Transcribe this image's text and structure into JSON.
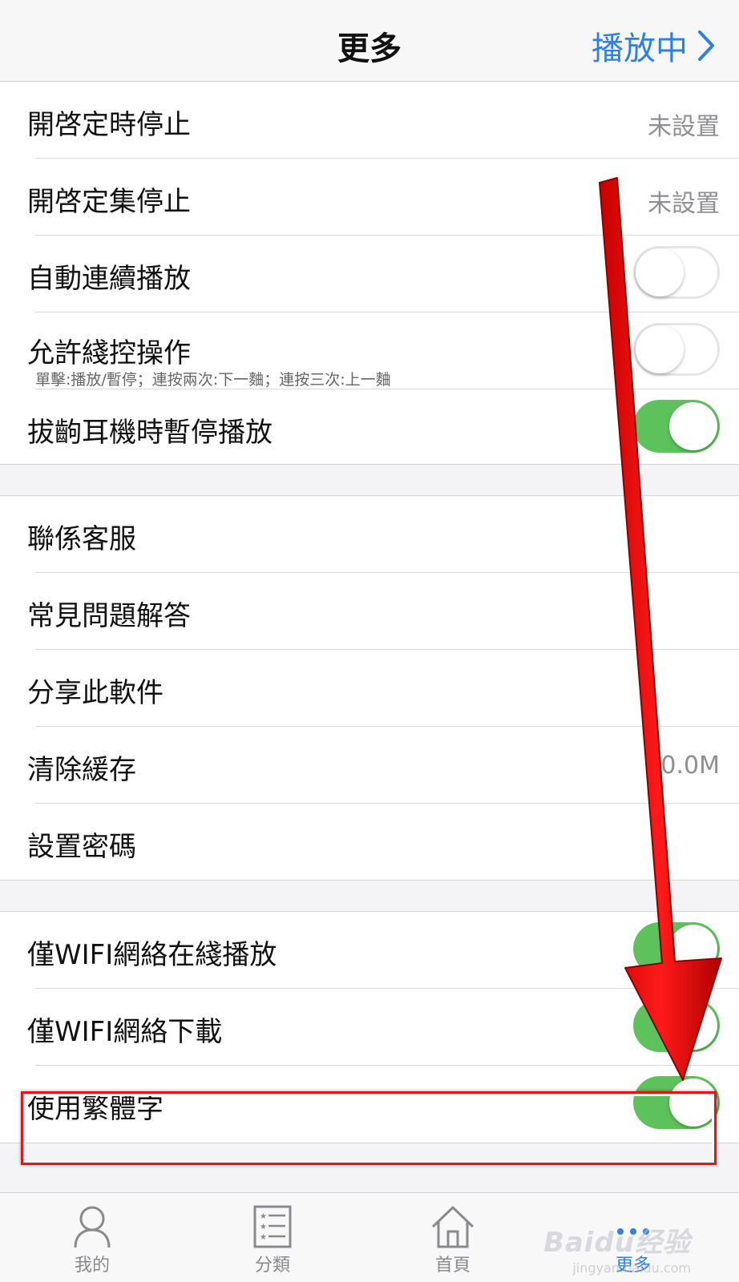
{
  "nav": {
    "title": "更多",
    "now_playing": "播放中"
  },
  "group1": [
    {
      "label": "開啓定時停止",
      "value": "未設置"
    },
    {
      "label": "開啓定集停止",
      "value": "未設置"
    },
    {
      "label": "自動連續播放",
      "toggle": "off"
    },
    {
      "label": "允許綫控操作",
      "sub": "單擊:播放/暫停；連按兩次:下一麯；連按三次:上一麯",
      "toggle": "off"
    },
    {
      "label": "拔齣耳機時暫停播放",
      "toggle": "on"
    }
  ],
  "group2": [
    {
      "label": "聯係客服"
    },
    {
      "label": "常見問題解答"
    },
    {
      "label": "分享此軟件"
    },
    {
      "label": "清除緩存",
      "value": "0.0M"
    },
    {
      "label": "設置密碼"
    }
  ],
  "group3": [
    {
      "label": "僅WIFI網絡在綫播放",
      "toggle": "on"
    },
    {
      "label": "僅WIFI網絡下載",
      "toggle": "on"
    },
    {
      "label": "使用繁體字",
      "toggle": "on"
    }
  ],
  "tabs": [
    {
      "label": "我的",
      "icon": "person-icon"
    },
    {
      "label": "分類",
      "icon": "list-icon"
    },
    {
      "label": "首頁",
      "icon": "home-icon"
    },
    {
      "label": "更多",
      "icon": "more-icon",
      "active": true
    }
  ],
  "watermark": {
    "brand": "Baidu经验",
    "url": "jingyan.baidu.com"
  },
  "colors": {
    "accent": "#2e7fe6",
    "toggle_on": "#5ec25c",
    "highlight": "#e3141a",
    "arrow": "#ff1010"
  }
}
